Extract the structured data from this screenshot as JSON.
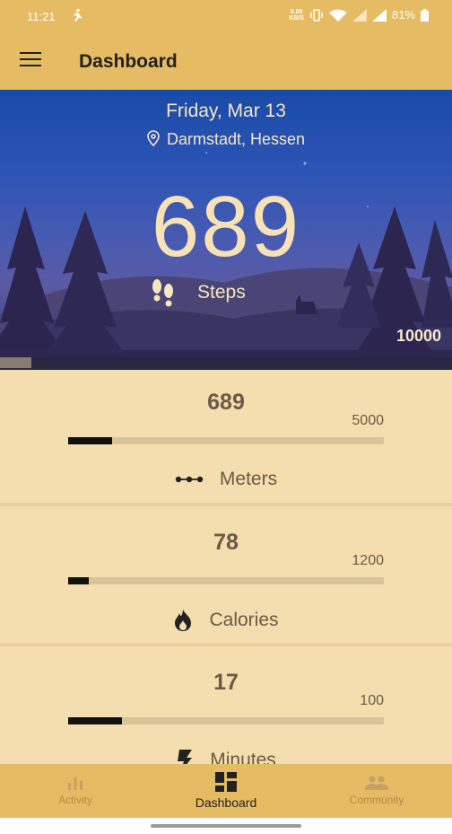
{
  "status_bar": {
    "time": "11:21",
    "net_speed_value": "0.00",
    "net_speed_unit": "KB/S",
    "battery_percent": "81%"
  },
  "app_bar": {
    "title": "Dashboard"
  },
  "hero": {
    "date": "Friday, Mar 13",
    "location": "Darmstadt, Hessen",
    "steps": "689",
    "steps_label": "Steps",
    "goal": "10000",
    "progress_fraction": 0.0689
  },
  "cards": [
    {
      "value": "689",
      "target": "5000",
      "label": "Meters",
      "icon": "route-dots-icon",
      "progress_fraction": 0.1378
    },
    {
      "value": "78",
      "target": "1200",
      "label": "Calories",
      "icon": "flame-icon",
      "progress_fraction": 0.065
    },
    {
      "value": "17",
      "target": "100",
      "label": "Minutes",
      "icon": "bolt-icon",
      "progress_fraction": 0.17
    }
  ],
  "bottom_nav": {
    "items": [
      {
        "label": "Activity",
        "icon": "bar-chart-icon",
        "active": false
      },
      {
        "label": "Dashboard",
        "icon": "dashboard-grid-icon",
        "active": true
      },
      {
        "label": "Community",
        "icon": "people-icon",
        "active": false
      }
    ]
  },
  "colors": {
    "accent": "#e5bb63",
    "card_bg": "#f4deb0",
    "bar_track": "#d8c39b",
    "bar_fill": "#111111"
  }
}
